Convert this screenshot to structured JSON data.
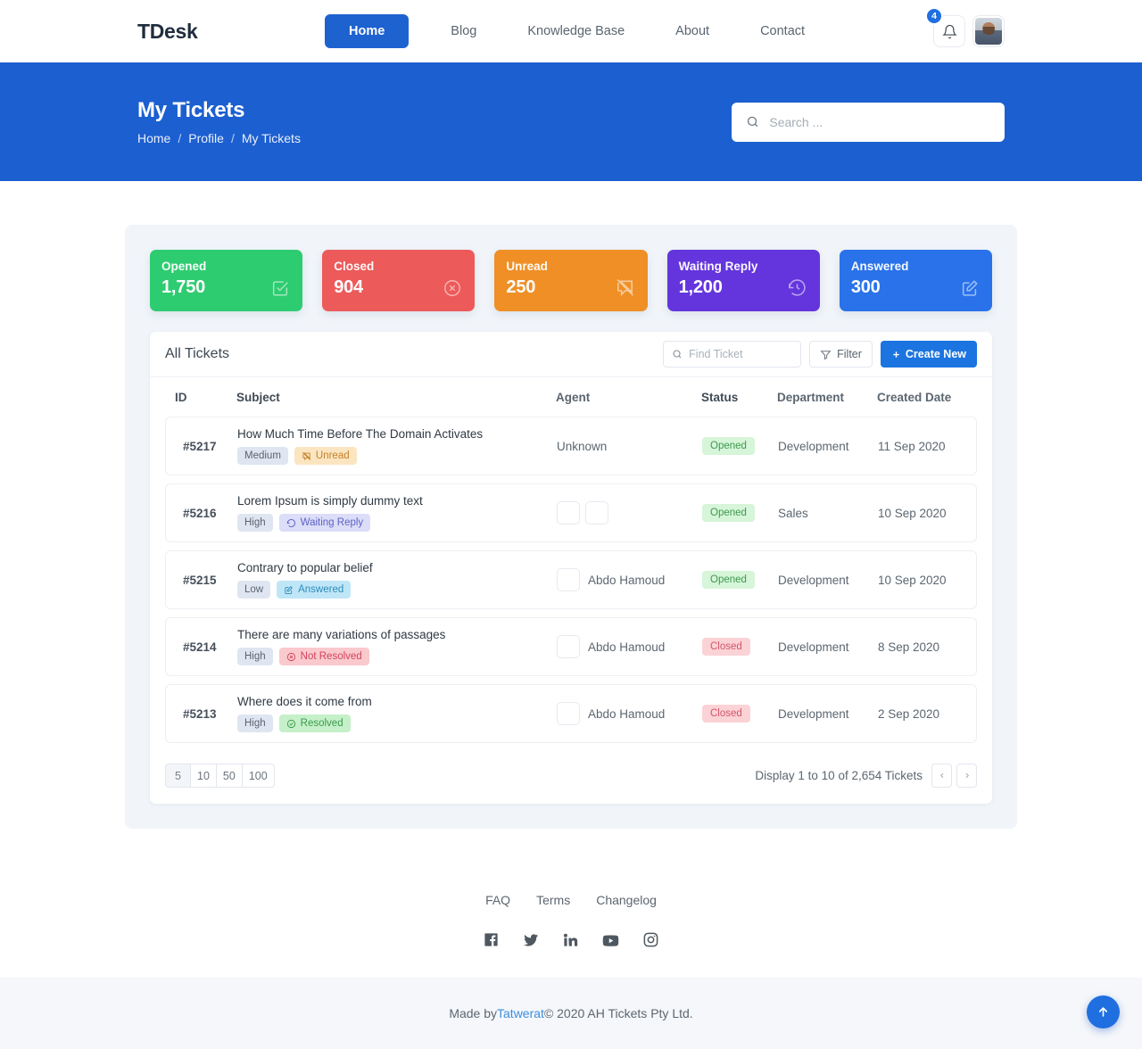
{
  "header": {
    "brand": "TDesk",
    "nav": [
      {
        "label": "Home",
        "active": true
      },
      {
        "label": "Blog",
        "active": false
      },
      {
        "label": "Knowledge Base",
        "active": false
      },
      {
        "label": "About",
        "active": false
      },
      {
        "label": "Contact",
        "active": false
      }
    ],
    "notification_count": "4",
    "bell_icon": "bell-icon",
    "avatar_icon": "user-avatar"
  },
  "hero": {
    "title": "My Tickets",
    "breadcrumb": [
      {
        "label": "Home"
      },
      {
        "label": "Profile"
      },
      {
        "label": "My Tickets"
      }
    ],
    "separator": "/",
    "search_placeholder": "Search ...",
    "search_value": "",
    "bg_color": "#1c5fd0"
  },
  "stats": [
    {
      "label": "Opened",
      "value": "1,750",
      "color": "#2ecc71",
      "icon": "check-square-icon"
    },
    {
      "label": "Closed",
      "value": "904",
      "color": "#ec5a5a",
      "icon": "x-circle-icon"
    },
    {
      "label": "Unread",
      "value": "250",
      "color": "#ef8f26",
      "icon": "comment-slash-icon"
    },
    {
      "label": "Waiting Reply",
      "value": "1,200",
      "color": "#6435dd",
      "icon": "history-icon"
    },
    {
      "label": "Answered",
      "value": "300",
      "color": "#2a72ea",
      "icon": "edit-square-icon"
    }
  ],
  "tickets_card": {
    "title": "All Tickets",
    "find_placeholder": "Find Ticket",
    "find_value": "",
    "filter_label": "Filter",
    "create_label": "Create New",
    "create_color": "#1b74e0"
  },
  "table": {
    "columns": [
      "ID",
      "Subject",
      "Agent",
      "Status",
      "Department",
      "Created Date"
    ],
    "rows": [
      {
        "id": "#5217",
        "subject": "How Much Time Before The Domain Activates",
        "priority": "Medium",
        "tag": {
          "label": "Unread",
          "type": "unread",
          "icon": "comment-slash-icon"
        },
        "agent": "Unknown",
        "avatars": 0,
        "status": "Opened",
        "status_type": "opened",
        "department": "Development",
        "created": "11 Sep 2020"
      },
      {
        "id": "#5216",
        "subject": "Lorem Ipsum is simply dummy text",
        "priority": "High",
        "tag": {
          "label": "Waiting Reply",
          "type": "waiting",
          "icon": "history-icon"
        },
        "agent": "",
        "avatars": 2,
        "status": "Opened",
        "status_type": "opened",
        "department": "Sales",
        "created": "10 Sep 2020"
      },
      {
        "id": "#5215",
        "subject": "Contrary to popular belief",
        "priority": "Low",
        "tag": {
          "label": "Answered",
          "type": "answered",
          "icon": "edit-square-icon"
        },
        "agent": "Abdo Hamoud",
        "avatars": 1,
        "status": "Opened",
        "status_type": "opened",
        "department": "Development",
        "created": "10 Sep 2020"
      },
      {
        "id": "#5214",
        "subject": "There are many variations of passages",
        "priority": "High",
        "tag": {
          "label": "Not Resolved",
          "type": "notres",
          "icon": "x-circle-icon"
        },
        "agent": "Abdo Hamoud",
        "avatars": 1,
        "status": "Closed",
        "status_type": "closed",
        "department": "Development",
        "created": "8 Sep 2020"
      },
      {
        "id": "#5213",
        "subject": "Where does it come from",
        "priority": "High",
        "tag": {
          "label": "Resolved",
          "type": "resolved",
          "icon": "check-circle-icon"
        },
        "agent": "Abdo Hamoud",
        "avatars": 1,
        "status": "Closed",
        "status_type": "closed",
        "department": "Development",
        "created": "2 Sep 2020"
      }
    ]
  },
  "pagination": {
    "sizes": [
      "5",
      "10",
      "50",
      "100"
    ],
    "active_size": "5",
    "info": "Display 1 to 10 of 2,654 Tickets",
    "prev_icon": "chevron-left-icon",
    "next_icon": "chevron-right-icon"
  },
  "footer": {
    "links": [
      "FAQ",
      "Terms",
      "Changelog"
    ],
    "social": [
      "facebook-icon",
      "twitter-icon",
      "linkedin-icon",
      "youtube-icon",
      "instagram-icon"
    ],
    "copyright_prefix": "Made by ",
    "copyright_link": "Tatwerat",
    "copyright_suffix": " © 2020 AH Tickets Pty Ltd."
  },
  "scroll_top": {
    "icon": "arrow-up-icon",
    "color": "#1f6fe0"
  }
}
